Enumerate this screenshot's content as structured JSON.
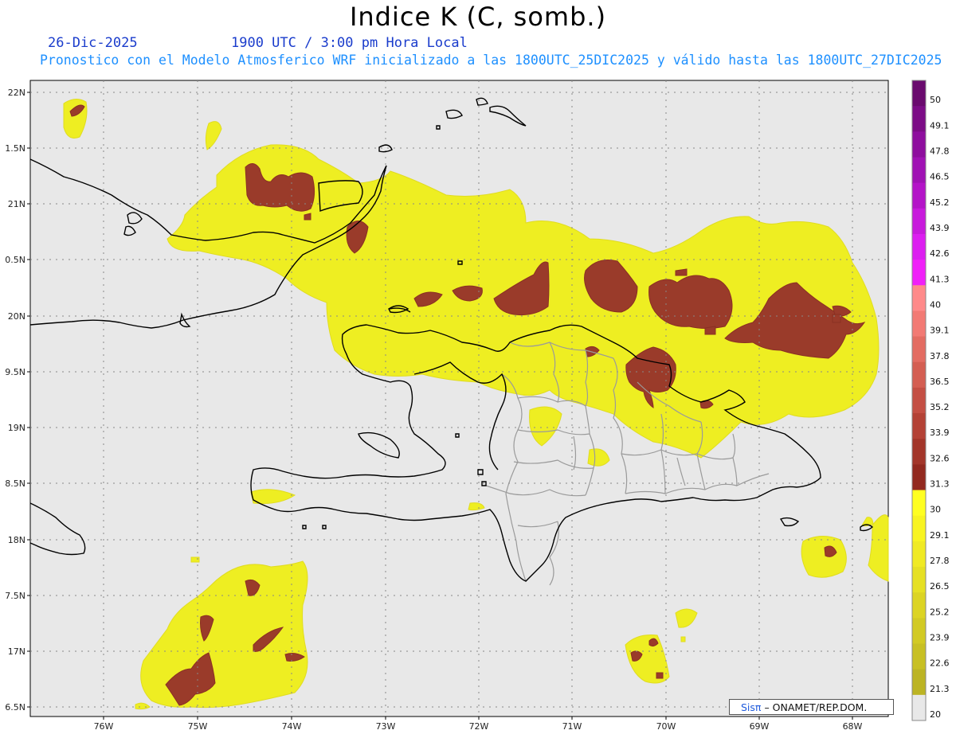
{
  "header": {
    "title": "Indice K (C, somb.)",
    "date": "26-Dic-2025",
    "time": "1900 UTC / 3:00 pm Hora Local",
    "info": "Pronostico con el Modelo Atmosferico WRF inicializado a las 1800UTC_25DIC2025 y válido hasta las  1800UTC_27DIC2025"
  },
  "axes": {
    "lat_labels": [
      "22N",
      "1.5N",
      "21N",
      "0.5N",
      "20N",
      "9.5N",
      "19N",
      "8.5N",
      "18N",
      "7.5N",
      "17N",
      "6.5N"
    ],
    "lon_labels": [
      "76W",
      "75W",
      "74W",
      "73W",
      "72W",
      "71W",
      "70W",
      "69W",
      "68W"
    ]
  },
  "colorbar": {
    "labels": [
      "50",
      "49.1",
      "47.8",
      "46.5",
      "45.2",
      "43.9",
      "42.6",
      "41.3",
      "40",
      "39.1",
      "37.8",
      "36.5",
      "35.2",
      "33.9",
      "32.6",
      "31.3",
      "30",
      "29.1",
      "27.8",
      "26.5",
      "25.2",
      "23.9",
      "22.6",
      "21.3",
      "20"
    ],
    "colors": [
      "#6a0a6e",
      "#7c0c86",
      "#8e0e9e",
      "#a012b4",
      "#b414c8",
      "#c81adc",
      "#dc1ef0",
      "#f020f8",
      "#ff8a8a",
      "#f27a74",
      "#e36c62",
      "#d45e52",
      "#c44f44",
      "#b44236",
      "#a3362a",
      "#92291f",
      "#ffff22",
      "#f8f422",
      "#f0ea24",
      "#e6e024",
      "#dcd424",
      "#d2ca24",
      "#c8c024",
      "#bcb424",
      "#e8e8e8"
    ]
  },
  "credit": {
    "brand": "Sisπ",
    "text": "– ONAMET/REP.DOM."
  },
  "colors": {
    "map_background": "#e8e8e8",
    "fill_low": "#eeee22",
    "fill_high": "#9a3b2a",
    "coast": "#000000",
    "province_border": "#9a9a9a"
  }
}
